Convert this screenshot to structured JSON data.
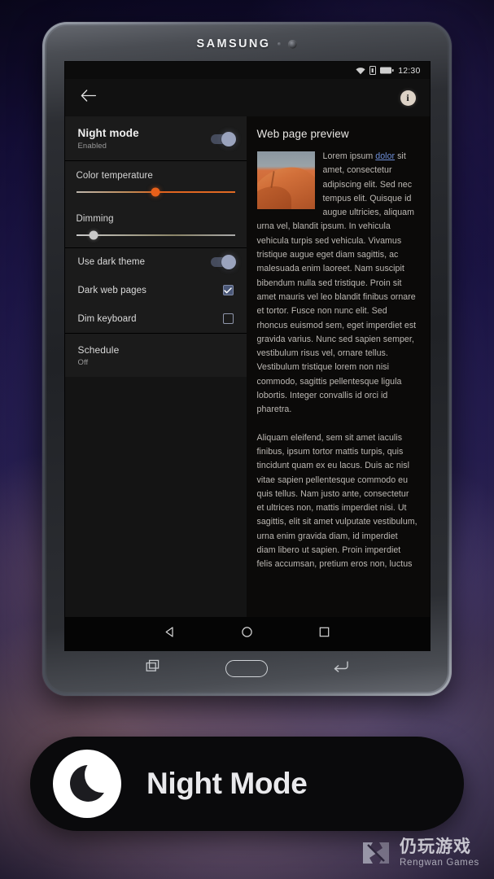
{
  "device": {
    "brand": "SAMSUNG",
    "sensor_icon": "proximity-sensor",
    "camera_icon": "front-camera"
  },
  "statusbar": {
    "wifi_icon": "wifi-icon",
    "sim_icon": "sim-card-icon",
    "battery_icon": "battery-icon",
    "clock": "12:30"
  },
  "appbar": {
    "back_icon": "back-arrow-icon",
    "info_label": "i",
    "info_icon": "info-icon"
  },
  "settings": {
    "night_mode": {
      "title": "Night mode",
      "subtitle": "Enabled",
      "toggle_state": "on"
    },
    "color_temperature": {
      "label": "Color temperature",
      "value_percent": 50,
      "accent": "#e8601a"
    },
    "dimming": {
      "label": "Dimming",
      "value_percent": 11,
      "accent": "#c9c9c9"
    },
    "use_dark_theme": {
      "label": "Use dark theme",
      "toggle_state": "on"
    },
    "dark_web_pages": {
      "label": "Dark web pages",
      "checked": true
    },
    "dim_keyboard": {
      "label": "Dim keyboard",
      "checked": false
    },
    "schedule": {
      "title": "Schedule",
      "subtitle": "Off"
    }
  },
  "preview": {
    "title": "Web page preview",
    "thumbnail_icon": "desert-dune-photo",
    "link_text": "dolor",
    "paragraph1_before": "Lorem ipsum ",
    "paragraph1_after": " sit amet, consectetur adipiscing elit. Sed nec tempus elit. Quisque id augue ultricies, aliquam urna vel, blandit ipsum. In vehicula vehicula turpis sed vehicula. Vivamus tristique augue eget diam sagittis, ac malesuada enim laoreet. Nam suscipit bibendum nulla sed tristique. Proin sit amet mauris vel leo blandit finibus ornare et tortor. Fusce non nunc elit. Sed rhoncus euismod sem, eget imperdiet est gravida varius. Nunc sed sapien semper, vestibulum risus vel, ornare tellus. Vestibulum tristique lorem non nisi commodo, sagittis pellentesque ligula lobortis. Integer convallis id orci id pharetra.",
    "paragraph2": "Aliquam eleifend, sem sit amet iaculis finibus, ipsum tortor mattis turpis, quis tincidunt quam ex eu lacus. Duis ac nisl vitae sapien pellentesque commodo eu quis tellus. Nam justo ante, consectetur et ultrices non, mattis imperdiet nisi. Ut sagittis, elit sit amet vulputate vestibulum, urna enim gravida diam, id imperdiet diam libero ut sapien. Proin imperdiet felis accumsan, pretium eros non, luctus"
  },
  "navbar": {
    "back_icon": "nav-back-triangle-icon",
    "home_icon": "nav-home-circle-icon",
    "recents_icon": "nav-recents-square-icon"
  },
  "hardware_keys": {
    "recents_icon": "hw-recents-icon",
    "home_icon": "hw-home-pill",
    "back_icon": "hw-back-arrow-icon"
  },
  "banner": {
    "icon": "crescent-moon-icon",
    "title": "Night Mode"
  },
  "watermark": {
    "logo_icon": "rengwan-logo-icon",
    "name_cn": "仍玩游戏",
    "name_en": "Rengwan Games"
  }
}
